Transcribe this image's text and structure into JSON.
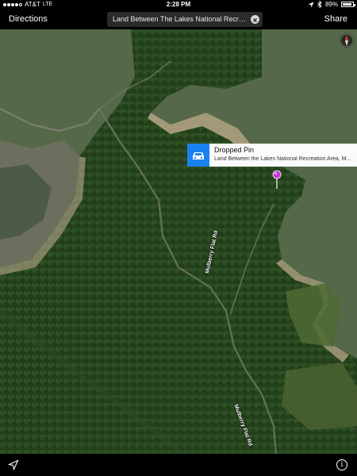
{
  "status_bar": {
    "carrier": "AT&T",
    "network": "LTE",
    "time": "2:28 PM",
    "battery_percent": "89%",
    "battery_level": 0.89,
    "signal_bars_filled": 4,
    "signal_bars_total": 5
  },
  "nav_bar": {
    "directions_label": "Directions",
    "search_value": "Land Between The Lakes National Recreatio...",
    "share_label": "Share"
  },
  "map": {
    "road_labels": [
      "Mulberry Flat Rd",
      "Mulberry Flat Rd"
    ],
    "colors": {
      "water": "#55684a",
      "forest": "#2a4a20",
      "shore": "#b8a88a",
      "accent": "#1a82f0",
      "pin": "#c03ad8"
    }
  },
  "callout": {
    "title": "Dropped Pin",
    "subtitle": "Land Between the Lakes National Recreation Area, M...",
    "icon": "car-icon"
  },
  "bottom_bar": {
    "left_icon": "location-arrow-icon",
    "right_icon": "info-icon",
    "info_glyph": "i"
  }
}
